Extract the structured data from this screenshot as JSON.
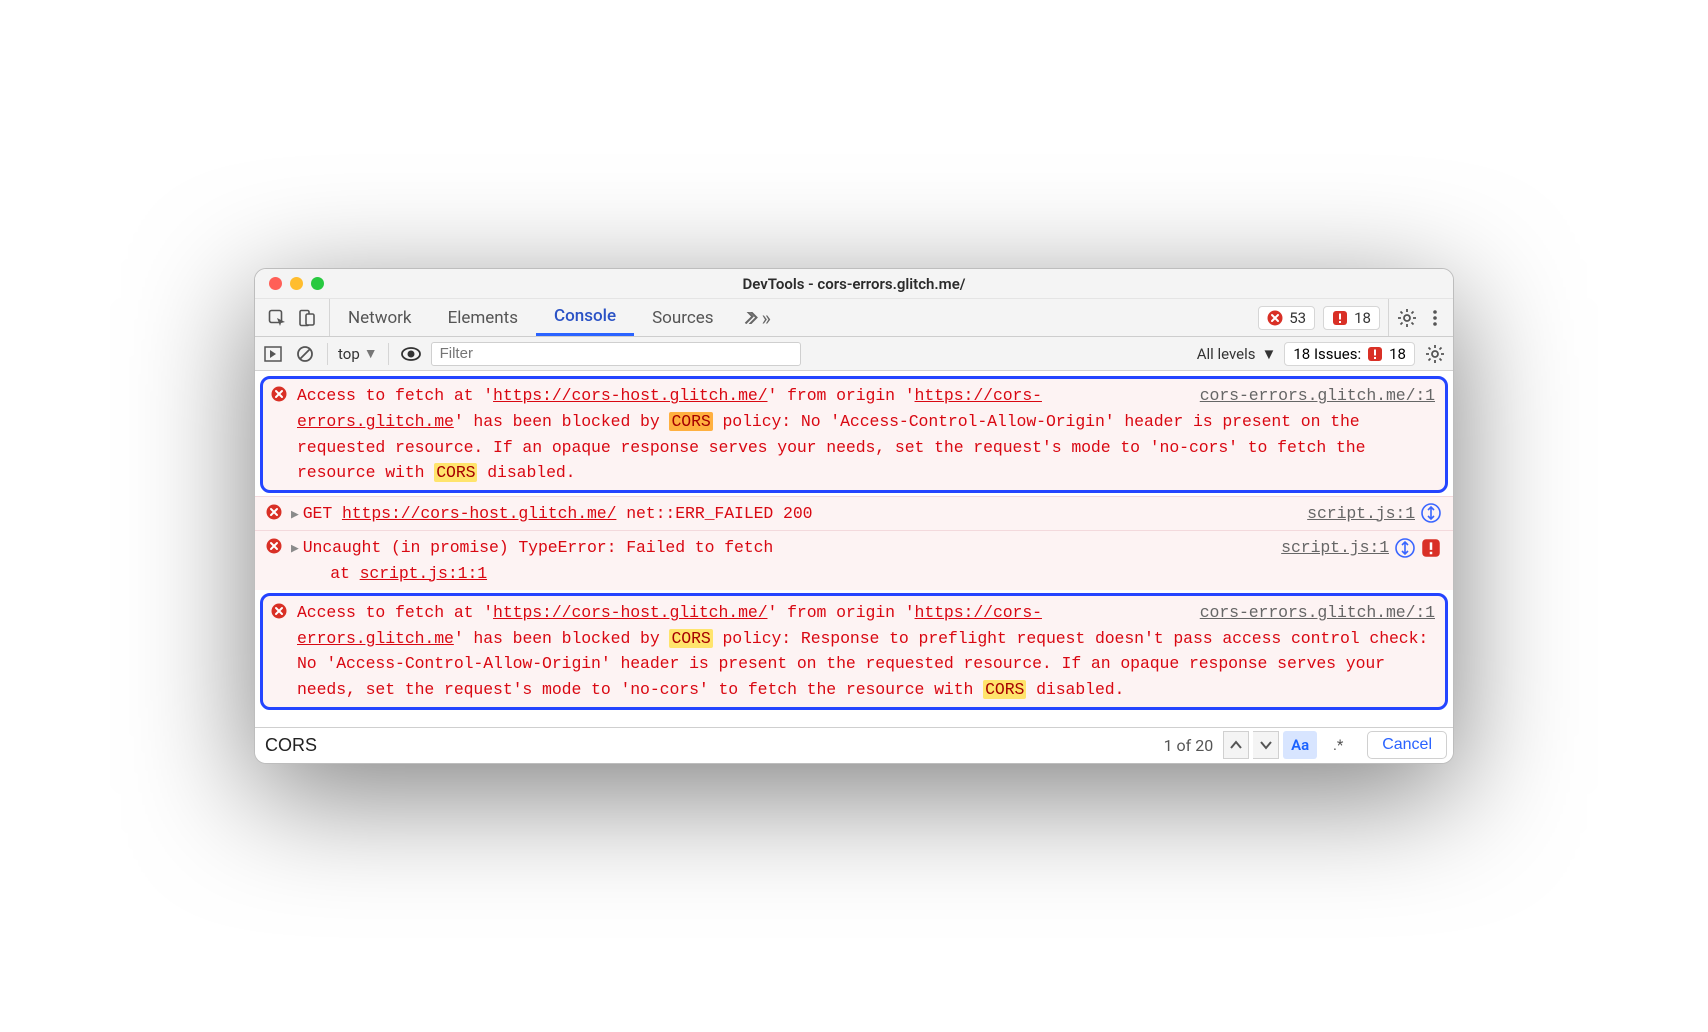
{
  "window": {
    "title": "DevTools - cors-errors.glitch.me/"
  },
  "tabs": {
    "network": "Network",
    "elements": "Elements",
    "console": "Console",
    "sources": "Sources"
  },
  "topbadges": {
    "errors": "53",
    "issues": "18"
  },
  "filter": {
    "context": "top",
    "placeholder": "Filter",
    "levels": "All levels",
    "issues_label": "18 Issues:",
    "issues_count": "18"
  },
  "entries": {
    "e0": {
      "text_pre": "Access to fetch at '",
      "url1": "https://cors-host.glitch.me/",
      "text_mid1": "' from origin '",
      "url2": "https://cors-errors.glitch.me",
      "text_mid2": "' has been blocked by ",
      "hl1": "CORS",
      "text_mid3": " policy: No 'Access-Control-Allow-Origin' header is present on the requested resource. If an opaque response serves your needs, set the request's mode to 'no-cors' to fetch the resource with ",
      "hl2": "CORS",
      "text_post": " disabled.",
      "loc": "cors-errors.glitch.me/:1"
    },
    "e1": {
      "method": "GET ",
      "url": "https://cors-host.glitch.me/",
      "status": " net::ERR_FAILED 200",
      "loc": "script.js:1"
    },
    "e2": {
      "line1": "Uncaught (in promise) TypeError: Failed to fetch",
      "line2_pre": "    at ",
      "line2_link": "script.js:1:1",
      "loc": "script.js:1"
    },
    "e3": {
      "text_pre": "Access to fetch at '",
      "url1": "https://cors-host.glitch.me/",
      "text_mid1": "' from origin '",
      "url2": "https://cors-errors.glitch.me",
      "text_mid2": "' has been blocked by ",
      "hl1": "CORS",
      "text_mid3": " policy: Response to preflight request doesn't pass access control check: No 'Access-Control-Allow-Origin' header is present on the requested resource. If an opaque response serves your needs, set the request's mode to 'no-cors' to fetch the resource with ",
      "hl2": "CORS",
      "text_post": " disabled.",
      "loc": "cors-errors.glitch.me/:1"
    }
  },
  "search": {
    "query": "CORS",
    "count": "1 of 20",
    "match_case": "Aa",
    "regex": ".*",
    "cancel": "Cancel"
  }
}
